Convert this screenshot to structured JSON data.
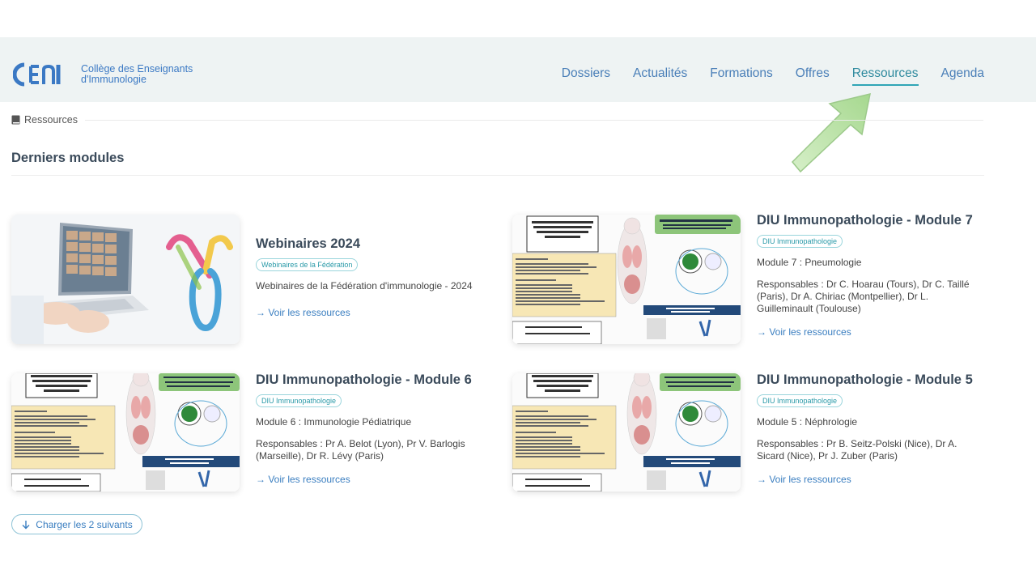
{
  "header": {
    "logo_text_line1": "Collège des Enseignants",
    "logo_text_line2": "d'Immunologie",
    "nav": [
      {
        "label": "Dossiers"
      },
      {
        "label": "Actualités"
      },
      {
        "label": "Formations"
      },
      {
        "label": "Offres"
      },
      {
        "label": "Ressources",
        "active": true
      },
      {
        "label": "Agenda"
      }
    ]
  },
  "breadcrumb": {
    "icon": "book-icon",
    "label": "Ressources"
  },
  "section": {
    "title": "Derniers modules"
  },
  "cards": [
    {
      "title": "Webinaires 2024",
      "tag": "Webinaires de la Fédération",
      "desc": "Webinaires de la Fédération d'immunologie - 2024",
      "link": "→ Voir les ressources"
    },
    {
      "title": "DIU Immunopathologie - Module 7",
      "tag": "DIU Immunopathologie",
      "desc": "Module 7 : Pneumologie",
      "responsables": "Responsables : Dr C. Hoarau (Tours), Dr C. Taillé (Paris), Dr A. Chiriac (Montpellier), Dr L. Guilleminault (Toulouse)",
      "link": "→ Voir les ressources"
    },
    {
      "title": "DIU Immunopathologie - Module 6",
      "tag": "DIU Immunopathologie",
      "desc": "Module 6 : Immunologie Pédiatrique",
      "responsables": "Responsables : Pr A. Belot (Lyon), Pr V. Barlogis (Marseille), Dr R. Lévy (Paris)",
      "link": "→ Voir les ressources"
    },
    {
      "title": "DIU Immunopathologie - Module 5",
      "tag": "DIU Immunopathologie",
      "desc": "Module 5 : Néphrologie",
      "responsables": "Responsables : Pr B. Seitz-Polski (Nice), Dr A. Sicard (Nice), Pr J. Zuber (Paris)",
      "link": "→ Voir les ressources"
    }
  ],
  "load_more": {
    "label": "Charger les 2 suivants",
    "icon": "arrow-down-icon"
  },
  "colors": {
    "accent": "#3a7ec0",
    "teal": "#2fa5b5",
    "header_bg": "#eef3f3",
    "arrow": "#b8e3a8"
  }
}
